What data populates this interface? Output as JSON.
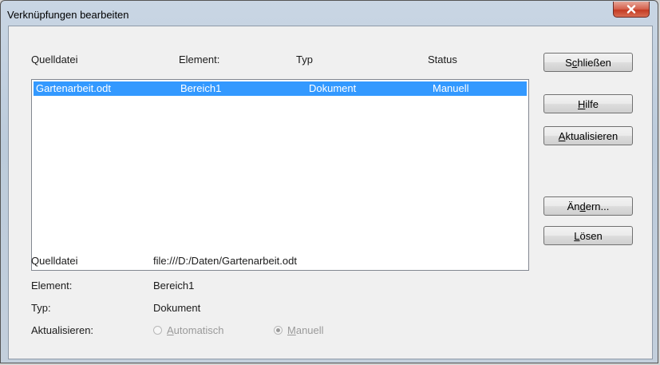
{
  "window": {
    "title": "Verknüpfungen bearbeiten"
  },
  "table": {
    "headers": [
      "Quelldatei",
      "Element:",
      "Typ",
      "Status"
    ],
    "rows": [
      {
        "source": "Gartenarbeit.odt",
        "element": "Bereich1",
        "type": "Dokument",
        "status": "Manuell",
        "selected": true
      }
    ]
  },
  "buttons": {
    "close": {
      "pre": "S",
      "mn": "c",
      "post": "hließen"
    },
    "help": {
      "pre": "",
      "mn": "H",
      "post": "ilfe"
    },
    "update": {
      "pre": "",
      "mn": "A",
      "post": "ktualisieren"
    },
    "modify": {
      "pre": "Än",
      "mn": "d",
      "post": "ern..."
    },
    "release": {
      "pre": "",
      "mn": "L",
      "post": "ösen"
    }
  },
  "details": {
    "source_label": "Quelldatei",
    "source_value": "file:///D:/Daten/Gartenarbeit.odt",
    "element_label": "Element:",
    "element_value": "Bereich1",
    "type_label": "Typ:",
    "type_value": "Dokument",
    "update_label": "Aktualisieren:",
    "auto": {
      "pre": "",
      "mn": "A",
      "post": "utomatisch",
      "checked": false,
      "enabled": false
    },
    "manual": {
      "pre": "",
      "mn": "M",
      "post": "anuell",
      "checked": true,
      "enabled": false
    }
  },
  "colors": {
    "selection": "#3399ff",
    "close_button": "#c94a33"
  }
}
